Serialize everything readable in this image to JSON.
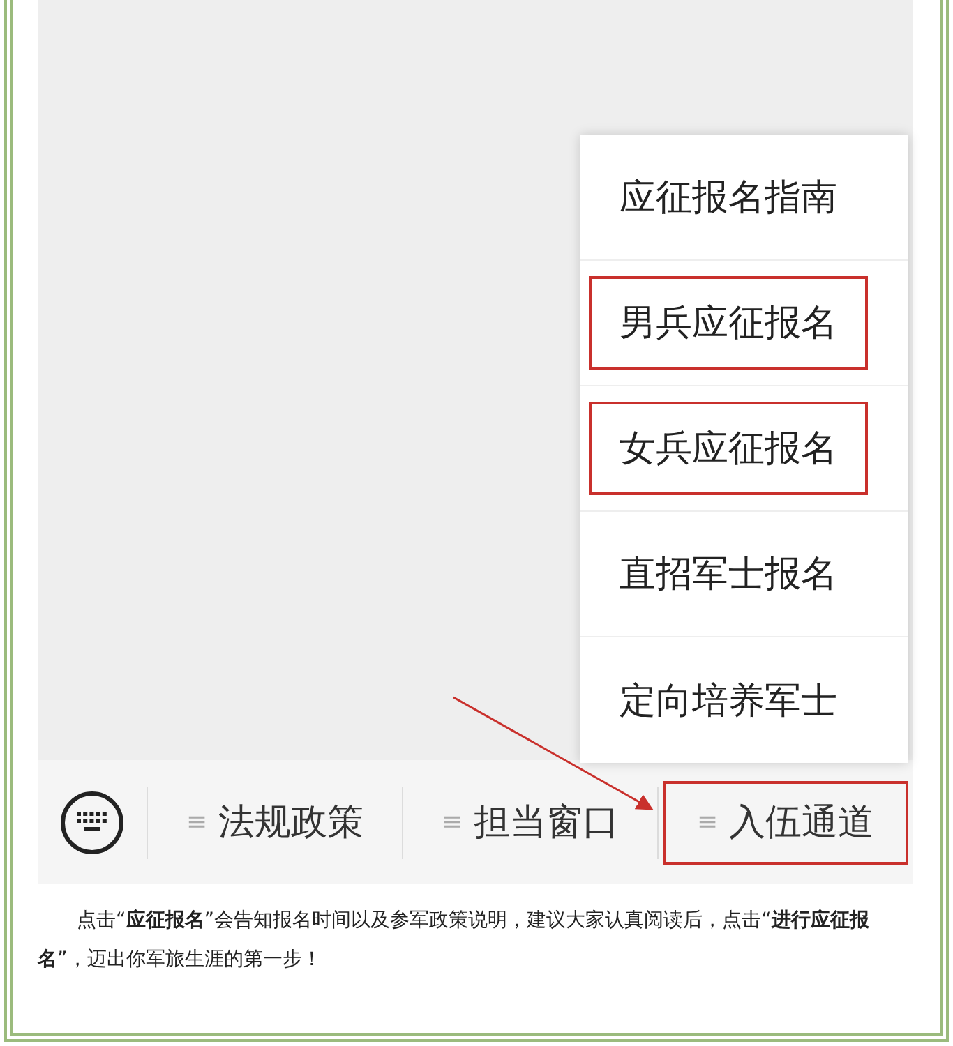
{
  "menu": {
    "items": [
      {
        "label": "应征报名指南",
        "highlighted": false
      },
      {
        "label": "男兵应征报名",
        "highlighted": true
      },
      {
        "label": "女兵应征报名",
        "highlighted": true
      },
      {
        "label": "直招军士报名",
        "highlighted": false
      },
      {
        "label": "定向培养军士",
        "highlighted": false
      }
    ]
  },
  "bottom_bar": {
    "tabs": [
      {
        "icon": "≡",
        "label": "法规政策",
        "highlighted": false
      },
      {
        "icon": "≡",
        "label": "担当窗口",
        "highlighted": false
      },
      {
        "icon": "≡",
        "label": "入伍通道",
        "highlighted": true
      }
    ]
  },
  "caption": "点击“**应征报名**”会告知报名时间以及参军政策说明，建议大家认真阅读后，点击“**进行应征报名**”，迈出你军旅生涯的第一步！"
}
